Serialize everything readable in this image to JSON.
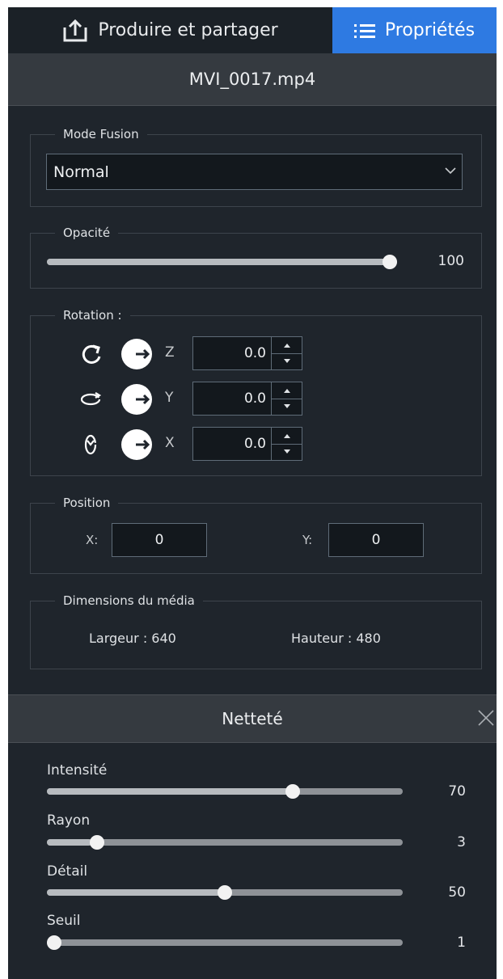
{
  "tabs": {
    "share_label": "Produire et partager",
    "properties_label": "Propriétés"
  },
  "file_name": "MVI_0017.mp4",
  "blend_mode": {
    "legend": "Mode Fusion",
    "value": "Normal"
  },
  "opacity": {
    "legend": "Opacité",
    "value": "100",
    "level": 1.0
  },
  "rotation": {
    "legend": "Rotation :",
    "rows": [
      {
        "axis": "Z",
        "value": "0.0"
      },
      {
        "axis": "Y",
        "value": "0.0"
      },
      {
        "axis": "X",
        "value": "0.0"
      }
    ]
  },
  "position": {
    "legend": "Position",
    "x_label": "X:",
    "x_value": "0",
    "y_label": "Y:",
    "y_value": "0"
  },
  "media_dimensions": {
    "legend": "Dimensions du média",
    "width_text": "Largeur : 640",
    "height_text": "Hauteur : 480"
  },
  "sharpness": {
    "title": "Netteté",
    "sliders": [
      {
        "label": "Intensité",
        "value": "70",
        "level": 0.7
      },
      {
        "label": "Rayon",
        "value": "3",
        "level": 0.125
      },
      {
        "label": "Détail",
        "value": "50",
        "level": 0.5
      },
      {
        "label": "Seuil",
        "value": "1",
        "level": 0.0
      }
    ]
  },
  "colors": {
    "accent": "#2e7ae2",
    "panel_bg": "#1f252c"
  }
}
